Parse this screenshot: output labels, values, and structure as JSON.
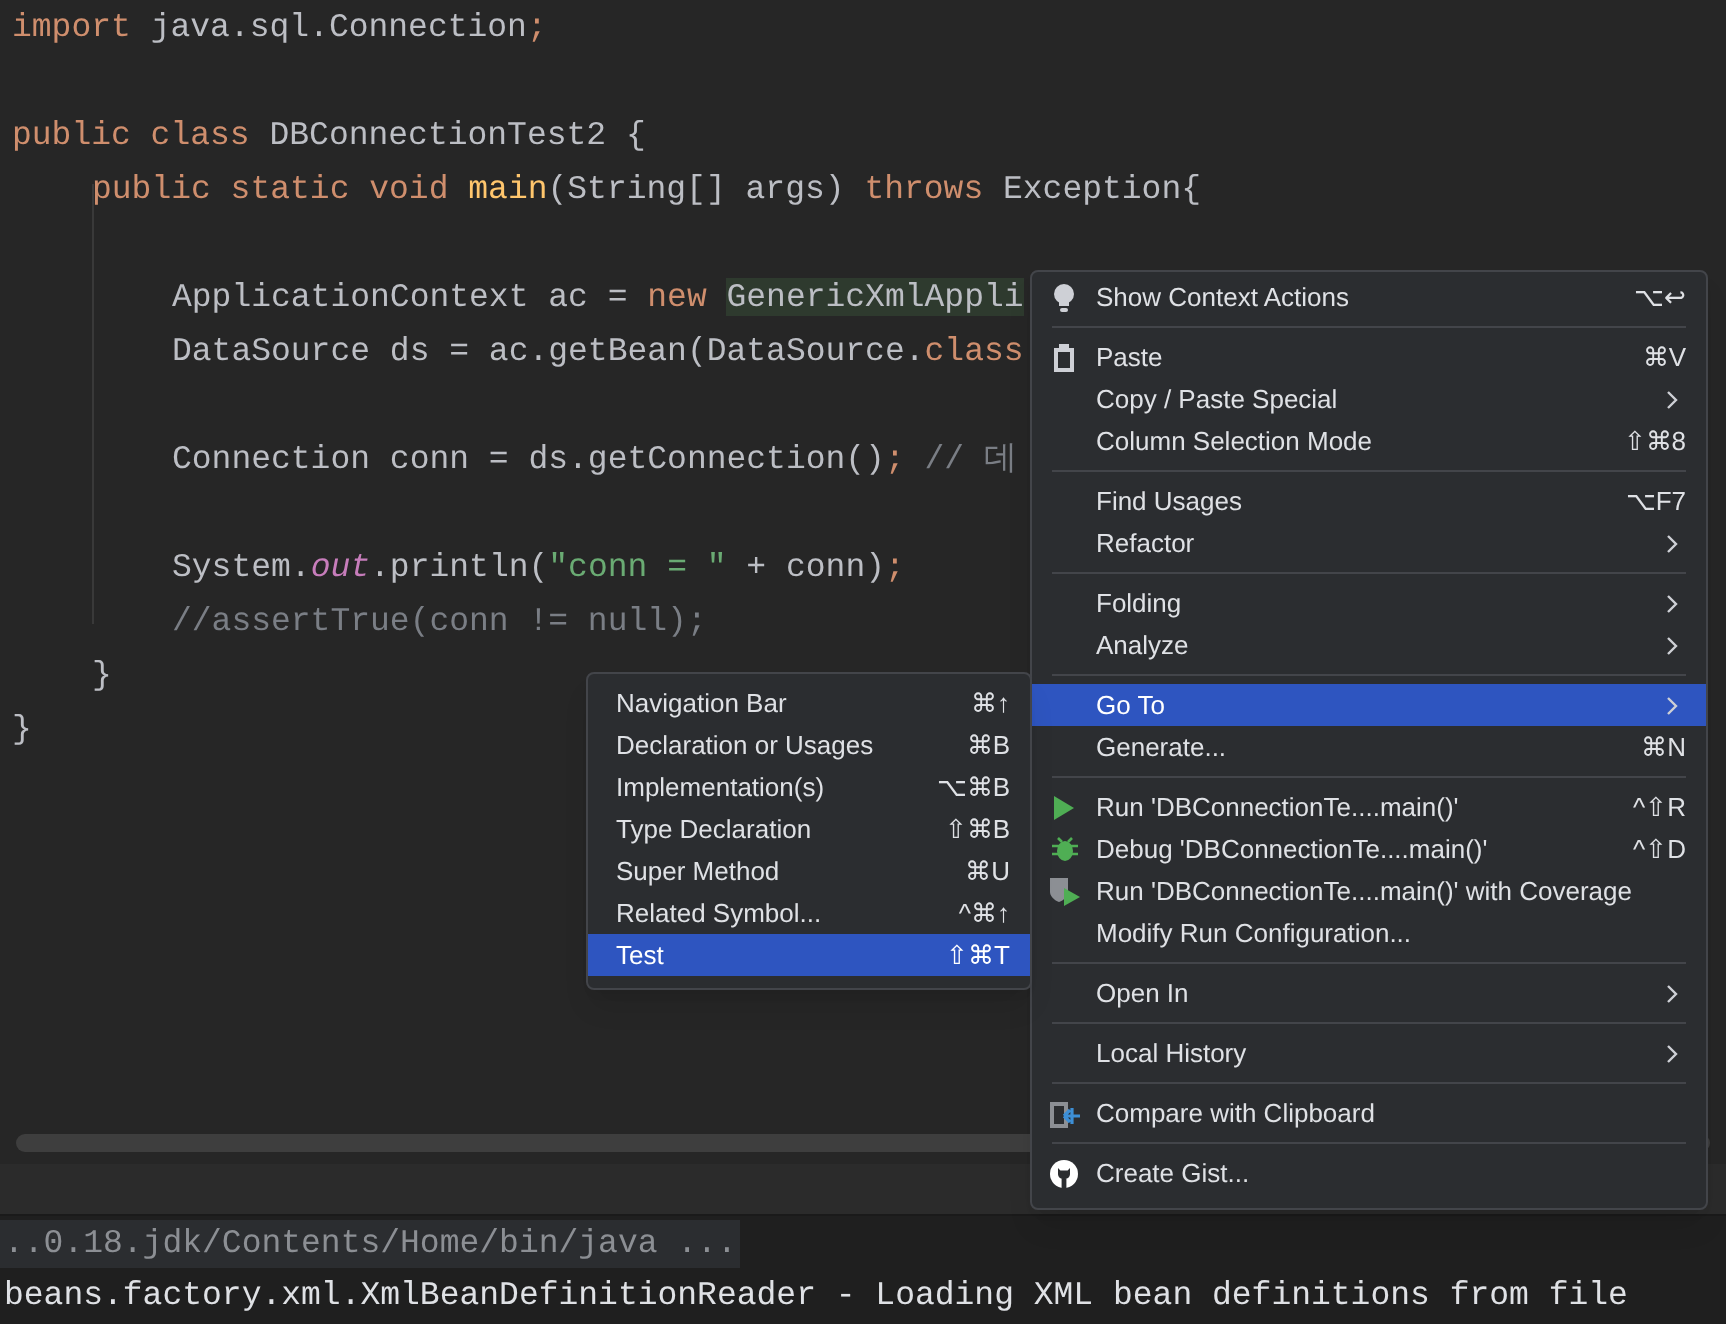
{
  "editor": {
    "lines": [
      {
        "kind": "code",
        "tokens": [
          {
            "kind": "keyword",
            "text": "import"
          },
          {
            "kind": "plain",
            "text": " java.sql.Connection"
          },
          {
            "kind": "punct",
            "text": ";"
          }
        ]
      },
      {
        "kind": "blank"
      },
      {
        "kind": "code",
        "tokens": [
          {
            "kind": "keyword",
            "text": "public class "
          },
          {
            "kind": "plain",
            "text": "DBConnectionTest2 {"
          }
        ],
        "children": [
          {
            "kind": "code",
            "tokens": [
              {
                "kind": "keyword",
                "text": "public static void "
              },
              {
                "kind": "method",
                "text": "main"
              },
              {
                "kind": "plain",
                "text": "(String[] args) "
              },
              {
                "kind": "keyword",
                "text": "throws "
              },
              {
                "kind": "plain",
                "text": "Exception{"
              }
            ],
            "children": [
              {
                "kind": "blank"
              },
              {
                "kind": "code",
                "tokens": [
                  {
                    "kind": "plain",
                    "text": "ApplicationContext ac = "
                  },
                  {
                    "kind": "keyword",
                    "text": "new "
                  },
                  {
                    "kind": "highlight",
                    "text": "GenericXmlAppli"
                  }
                ]
              },
              {
                "kind": "code",
                "tokens": [
                  {
                    "kind": "plain",
                    "text": "DataSource ds = ac.getBean(DataSource."
                  },
                  {
                    "kind": "keyword",
                    "text": "class"
                  }
                ]
              },
              {
                "kind": "blank"
              },
              {
                "kind": "code",
                "tokens": [
                  {
                    "kind": "plain",
                    "text": "Connection conn = ds.getConnection()"
                  },
                  {
                    "kind": "punct",
                    "text": ";"
                  },
                  {
                    "kind": "comment",
                    "text": " // 데"
                  }
                ]
              },
              {
                "kind": "blank"
              },
              {
                "kind": "code",
                "tokens": [
                  {
                    "kind": "plain",
                    "text": "System."
                  },
                  {
                    "kind": "field",
                    "text": "out"
                  },
                  {
                    "kind": "plain",
                    "text": ".println("
                  },
                  {
                    "kind": "string",
                    "text": "\"conn = \""
                  },
                  {
                    "kind": "plain",
                    "text": " + conn)"
                  },
                  {
                    "kind": "punct",
                    "text": ";"
                  }
                ]
              },
              {
                "kind": "code",
                "tokens": [
                  {
                    "kind": "comment",
                    "text": "//assertTrue(conn != null);"
                  }
                ]
              }
            ]
          },
          {
            "kind": "code",
            "tokens": [
              {
                "kind": "plain",
                "text": "}"
              }
            ]
          }
        ]
      },
      {
        "kind": "code",
        "tokens": [
          {
            "kind": "plain",
            "text": "}"
          }
        ]
      }
    ]
  },
  "console": {
    "lines": [
      {
        "text": "..0.18.jdk/Contents/Home/bin/java ...",
        "selected": true
      },
      {
        "text": "beans.factory.xml.XmlBeanDefinitionReader - Loading XML bean definitions from file",
        "selected": false
      }
    ]
  },
  "context_menu": {
    "items": [
      {
        "kind": "bulb",
        "label": "Show Context Actions",
        "shortcut": "⌥↩",
        "submenu": false,
        "selected": false
      },
      {
        "kind": "separator"
      },
      {
        "kind": "clipboard",
        "label": "Paste",
        "shortcut": "⌘V",
        "submenu": false,
        "selected": false
      },
      {
        "kind": "plain",
        "label": "Copy / Paste Special",
        "submenu": true,
        "selected": false
      },
      {
        "kind": "plain",
        "label": "Column Selection Mode",
        "shortcut": "⇧⌘8",
        "submenu": false,
        "selected": false
      },
      {
        "kind": "separator"
      },
      {
        "kind": "plain",
        "label": "Find Usages",
        "shortcut": "⌥F7",
        "submenu": false,
        "selected": false
      },
      {
        "kind": "plain",
        "label": "Refactor",
        "submenu": true,
        "selected": false
      },
      {
        "kind": "separator"
      },
      {
        "kind": "plain",
        "label": "Folding",
        "submenu": true,
        "selected": false
      },
      {
        "kind": "plain",
        "label": "Analyze",
        "submenu": true,
        "selected": false
      },
      {
        "kind": "separator"
      },
      {
        "kind": "plain",
        "label": "Go To",
        "submenu": true,
        "selected": true
      },
      {
        "kind": "plain",
        "label": "Generate...",
        "shortcut": "⌘N",
        "submenu": false,
        "selected": false
      },
      {
        "kind": "separator"
      },
      {
        "kind": "run",
        "label": "Run 'DBConnectionTe....main()'",
        "shortcut": "^⇧R",
        "submenu": false,
        "selected": false
      },
      {
        "kind": "debug",
        "label": "Debug 'DBConnectionTe....main()'",
        "shortcut": "^⇧D",
        "submenu": false,
        "selected": false
      },
      {
        "kind": "coverage",
        "label": "Run 'DBConnectionTe....main()' with Coverage",
        "submenu": false,
        "selected": false
      },
      {
        "kind": "plain",
        "label": "Modify Run Configuration...",
        "submenu": false,
        "selected": false
      },
      {
        "kind": "separator"
      },
      {
        "kind": "plain",
        "label": "Open In",
        "submenu": true,
        "selected": false
      },
      {
        "kind": "separator"
      },
      {
        "kind": "plain",
        "label": "Local History",
        "submenu": true,
        "selected": false
      },
      {
        "kind": "separator"
      },
      {
        "kind": "compare",
        "label": "Compare with Clipboard",
        "submenu": false,
        "selected": false
      },
      {
        "kind": "separator"
      },
      {
        "kind": "github",
        "label": "Create Gist...",
        "submenu": false,
        "selected": false
      }
    ]
  },
  "goto_submenu": {
    "items": [
      {
        "label": "Navigation Bar",
        "shortcut": "⌘↑",
        "selected": false
      },
      {
        "label": "Declaration or Usages",
        "shortcut": "⌘B",
        "selected": false
      },
      {
        "label": "Implementation(s)",
        "shortcut": "⌥⌘B",
        "selected": false
      },
      {
        "label": "Type Declaration",
        "shortcut": "⇧⌘B",
        "selected": false
      },
      {
        "label": "Super Method",
        "shortcut": "⌘U",
        "selected": false
      },
      {
        "label": "Related Symbol...",
        "shortcut": "^⌘↑",
        "selected": false
      },
      {
        "label": "Test",
        "shortcut": "⇧⌘T",
        "selected": true
      }
    ]
  }
}
